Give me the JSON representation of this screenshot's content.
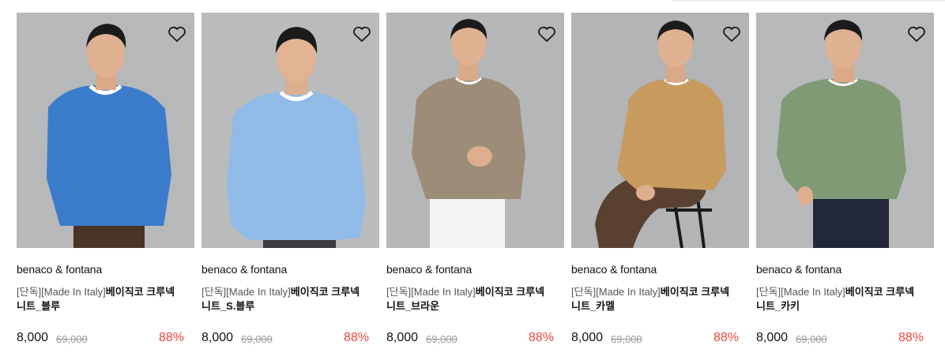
{
  "colors": {
    "discount": "#e8483a",
    "original_price": "#9a9a9a",
    "photo_background": "#b8babc"
  },
  "products": [
    {
      "brand": "benaco & fontana",
      "title_tag": "[단독][Made In Italy]",
      "title_name": "베이직코 크루넥 니트_블루",
      "sale_price": "8,000",
      "original_price": "69,000",
      "discount": "88%",
      "sweater_color": "#3a7ccb",
      "pants_color": "#4a3426",
      "wishlist_icon": "heart-outline-icon"
    },
    {
      "brand": "benaco & fontana",
      "title_tag": "[단독][Made In Italy]",
      "title_name": "베이직코 크루넥 니트_S.블루",
      "sale_price": "8,000",
      "original_price": "69,000",
      "discount": "88%",
      "sweater_color": "#8fbbe6",
      "pants_color": "#3d3b40",
      "wishlist_icon": "heart-outline-icon"
    },
    {
      "brand": "benaco & fontana",
      "title_tag": "[단독][Made In Italy]",
      "title_name": "베이직코 크루넥 니트_브라운",
      "sale_price": "8,000",
      "original_price": "69,000",
      "discount": "88%",
      "sweater_color": "#9c8c78",
      "pants_color": "#f3f3f3",
      "wishlist_icon": "heart-outline-icon"
    },
    {
      "brand": "benaco & fontana",
      "title_tag": "[단독][Made In Italy]",
      "title_name": "베이직코 크루넥 니트_카멜",
      "sale_price": "8,000",
      "original_price": "69,000",
      "discount": "88%",
      "sweater_color": "#c79a5e",
      "pants_color": "#5a4030",
      "wishlist_icon": "heart-outline-icon"
    },
    {
      "brand": "benaco & fontana",
      "title_tag": "[단독][Made In Italy]",
      "title_name": "베이직코 크루넥 니트_카키",
      "sale_price": "8,000",
      "original_price": "69,000",
      "discount": "88%",
      "sweater_color": "#7f9a75",
      "pants_color": "#22283a",
      "wishlist_icon": "heart-outline-icon"
    }
  ]
}
